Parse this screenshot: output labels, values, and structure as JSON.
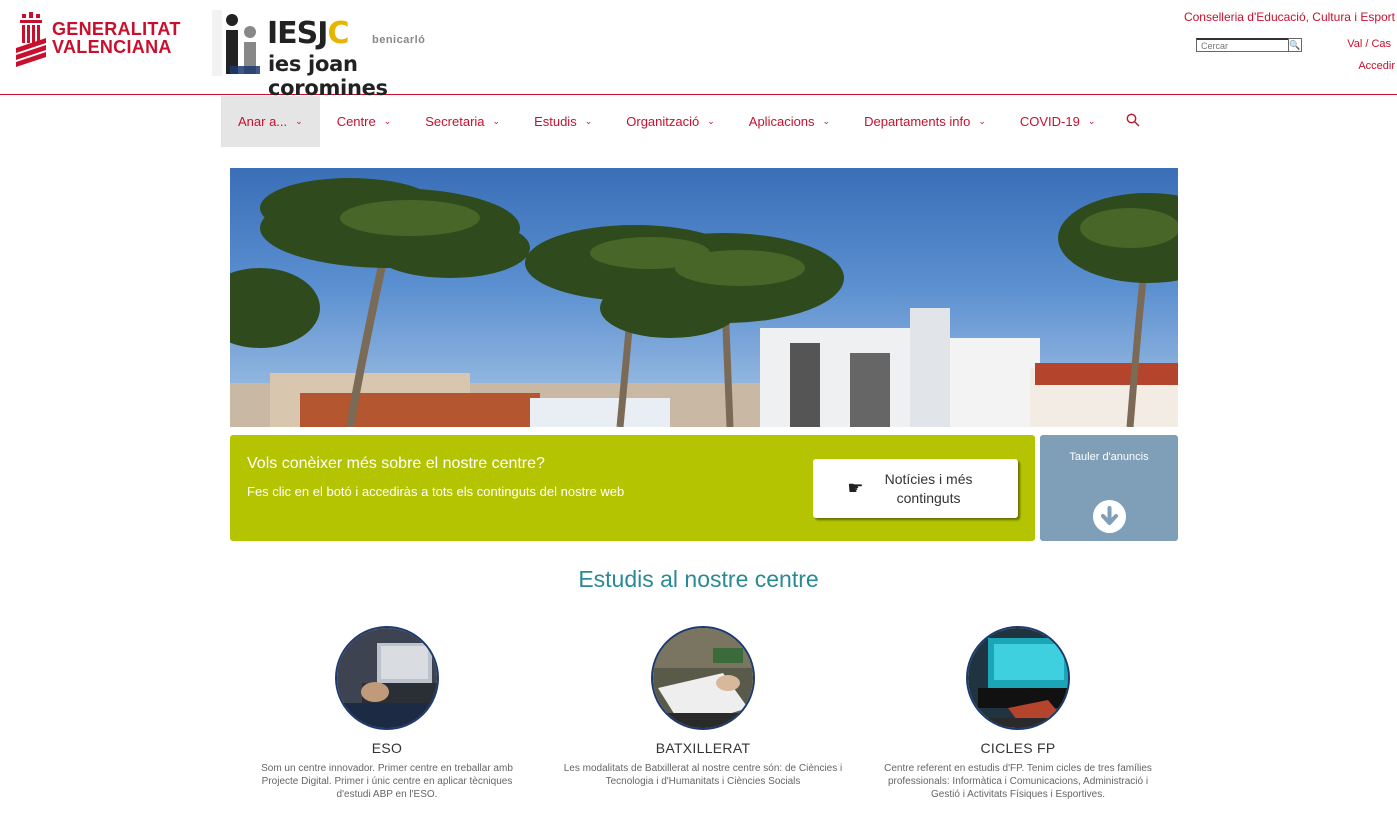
{
  "header": {
    "gv_line1": "GENERALITAT",
    "gv_line2": "VALENCIANA",
    "school_title_a": "IESJ",
    "school_title_b": "C",
    "school_sub": "ies joan coromines",
    "school_town": "benicarló",
    "conselleria": "Conselleria d'Educació, Cultura i Esport",
    "search_placeholder": "Cercar",
    "lang": "Val / Cas",
    "login": "Accedir"
  },
  "nav": {
    "items": [
      {
        "label": "Anar a..."
      },
      {
        "label": "Centre"
      },
      {
        "label": "Secretaria"
      },
      {
        "label": "Estudis"
      },
      {
        "label": "Organització"
      },
      {
        "label": "Aplicacions"
      },
      {
        "label": "Departaments info"
      },
      {
        "label": "COVID-19"
      }
    ],
    "active_index": 0
  },
  "banner": {
    "question": "Vols conèixer més sobre el nostre centre?",
    "text": "Fes clic en el botó i accediràs a tots els continguts del nostre web",
    "button_label": "Notícies i més continguts"
  },
  "tauler": {
    "label": "Tauler d'anuncis"
  },
  "studies": {
    "title": "Estudis al nostre centre",
    "items": [
      {
        "name": "ESO",
        "desc": "Som un centre innovador. Primer centre en treballar amb Projecte Digital. Primer i únic centre en aplicar tècniques d'estudi ABP en l'ESO."
      },
      {
        "name": "BATXILLERAT",
        "desc": "Les modalitats de Batxillerat al nostre centre són: de Ciències i Tecnologia i d'Humanitats i Ciències Socials"
      },
      {
        "name": "CICLES FP",
        "desc": "Centre referent en estudis d'FP. Tenim cicles de tres famílies professionals: Informàtica i Comunicacions, Administració i Gestió i Activitats Físiques i Esportives."
      }
    ]
  },
  "colors": {
    "brand_red": "#c8102e",
    "banner_green": "#b5c400",
    "tauler_blue": "#7f9eb8",
    "title_teal": "#2a8a94"
  }
}
